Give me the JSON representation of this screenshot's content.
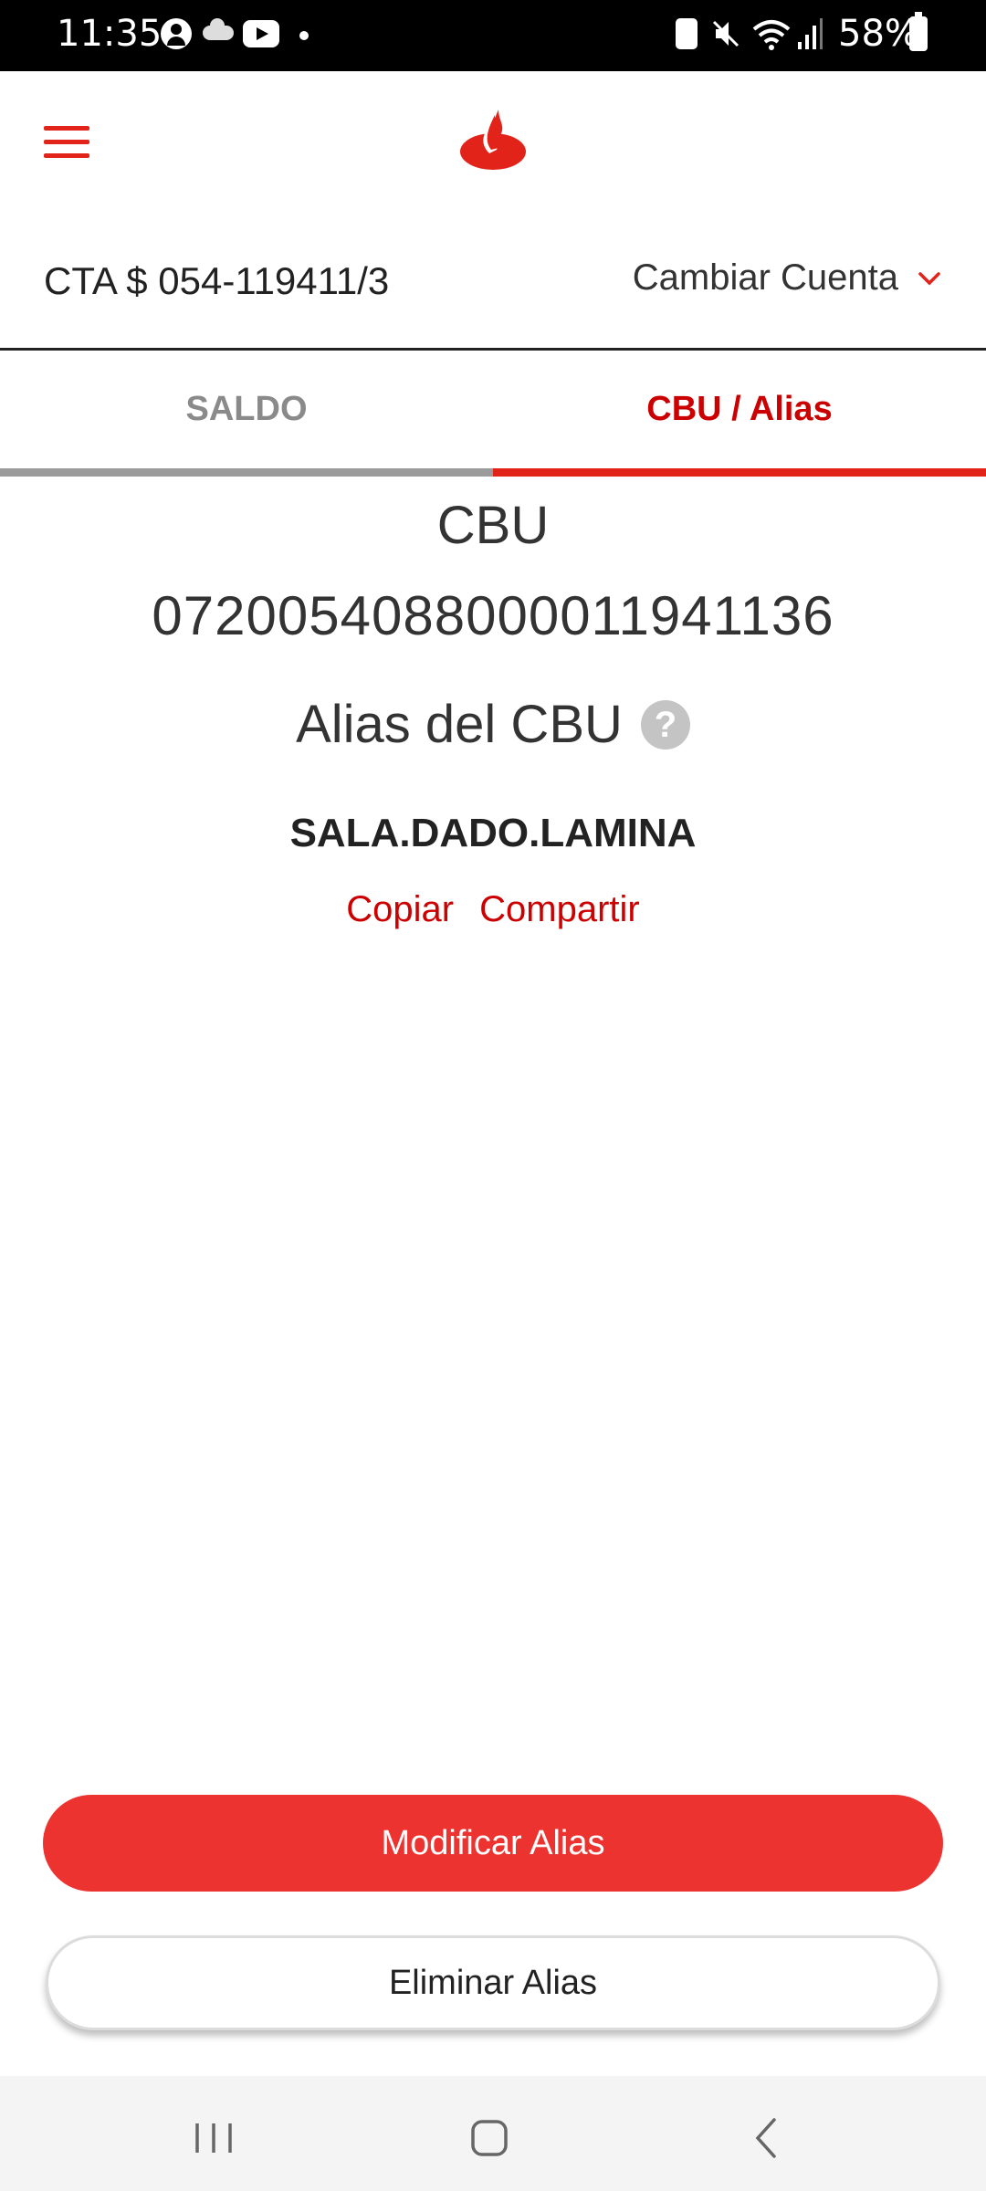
{
  "status_bar": {
    "time": "11:35",
    "battery": "58%"
  },
  "account": {
    "label": "CTA $ 054-119411/3",
    "change_label": "Cambiar Cuenta"
  },
  "tabs": [
    {
      "label": "SALDO",
      "active": false
    },
    {
      "label": "CBU / Alias",
      "active": true
    }
  ],
  "cbu": {
    "title": "CBU",
    "value": "0720054088000011941136"
  },
  "alias": {
    "title": "Alias del CBU",
    "help": "?",
    "value": "SALA.DADO.LAMINA",
    "copy_label": "Copiar",
    "share_label": "Compartir"
  },
  "buttons": {
    "modify": "Modificar Alias",
    "delete": "Eliminar Alias"
  },
  "colors": {
    "brand_red": "#ec3330",
    "link_red": "#cc0000",
    "inactive_tab": "#8a8a8a"
  },
  "icons": {
    "menu": "hamburger-icon",
    "logo": "santander-flame-icon",
    "change_account": "chevron-down-icon",
    "help": "question-circle-icon"
  }
}
